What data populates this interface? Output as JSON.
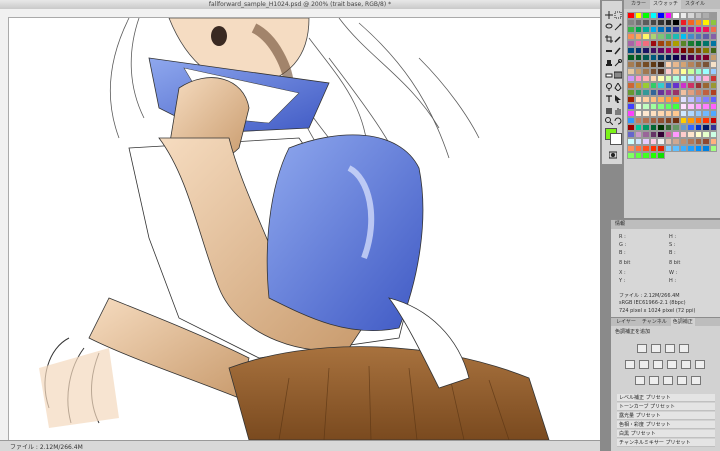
{
  "window": {
    "title": "fallforward_sample_H1024.psd @ 200% (trait base, RGB/8) *"
  },
  "status": {
    "text": "ファイル : 2.12M/266.4M"
  },
  "swatches": {
    "tabs": [
      "カラー",
      "スウォッチ",
      "スタイル"
    ],
    "active_tab": 1,
    "colors": [
      "#ff0000",
      "#ffff00",
      "#00ff00",
      "#00ffff",
      "#0000ff",
      "#ff00ff",
      "#ffffff",
      "#ebebeb",
      "#d6d6d6",
      "#c2c2c2",
      "#adadad",
      "#999999",
      "#858585",
      "#707070",
      "#5c5c5c",
      "#474747",
      "#333333",
      "#1f1f1f",
      "#000000",
      "#ee1d24",
      "#f26522",
      "#f7941d",
      "#fff200",
      "#8dc63f",
      "#39b54a",
      "#00a651",
      "#00a99d",
      "#00aeef",
      "#0072bc",
      "#0054a6",
      "#2e3192",
      "#662d91",
      "#92278f",
      "#ec008c",
      "#ed145b",
      "#f26c4f",
      "#f68e56",
      "#fbaf5d",
      "#fff568",
      "#acd373",
      "#7cc576",
      "#3cb878",
      "#1cbbb4",
      "#00bff3",
      "#448ccb",
      "#5574b9",
      "#605ca8",
      "#8560a8",
      "#a864a8",
      "#f06eaa",
      "#f26d7d",
      "#9e0b0f",
      "#a0410d",
      "#a36209",
      "#aba000",
      "#598527",
      "#197b30",
      "#007236",
      "#00746b",
      "#0076a3",
      "#004a80",
      "#003471",
      "#1b1464",
      "#440e62",
      "#630460",
      "#9e005d",
      "#9e0039",
      "#790000",
      "#7b2e00",
      "#7d4900",
      "#827b00",
      "#406618",
      "#005e20",
      "#005826",
      "#005952",
      "#005b7f",
      "#003663",
      "#002157",
      "#0d004c",
      "#32004b",
      "#4b0049",
      "#7b0046",
      "#7a0026",
      "#c69c6d",
      "#a67c52",
      "#8c6239",
      "#754c24",
      "#603913",
      "#3c2415",
      "#ffd2b0",
      "#e8b88e",
      "#d4a373",
      "#b5835a",
      "#996b46",
      "#7a5336",
      "#f5e1c8",
      "#e6c8a0",
      "#c8a070",
      "#a07850",
      "#785030",
      "#503020",
      "#ffcccc",
      "#ffcc99",
      "#ffff99",
      "#ccff99",
      "#99ffcc",
      "#99ffff",
      "#99ccff",
      "#cc99ff",
      "#ff99cc",
      "#ffb3b3",
      "#ffd9b3",
      "#ffffb3",
      "#d9ffb3",
      "#b3ffd9",
      "#b3ffff",
      "#b3d9ff",
      "#d9b3ff",
      "#ffb3d9",
      "#cc3333",
      "#cc6633",
      "#cc9933",
      "#99cc33",
      "#33cc66",
      "#33cccc",
      "#3366cc",
      "#6633cc",
      "#cc33cc",
      "#cc3366",
      "#993333",
      "#996633",
      "#999933",
      "#669933",
      "#339966",
      "#339999",
      "#336699",
      "#663399",
      "#993399",
      "#993366",
      "#f0c0a0",
      "#e0a080",
      "#d08060",
      "#c06040",
      "#b04020",
      "#a02000",
      "#ffe0c0",
      "#ffd0a0",
      "#ffc080",
      "#ffb060",
      "#ffa040",
      "#ff9020",
      "#e0e0ff",
      "#c0c0ff",
      "#a0a0ff",
      "#8080ff",
      "#6060ff",
      "#4040ff",
      "#e0ffe0",
      "#c0ffc0",
      "#a0ffa0",
      "#80ff80",
      "#60ff60",
      "#40ff40",
      "#ffe0ff",
      "#ffc0ff",
      "#ffa0ff",
      "#ff80ff",
      "#ff60ff",
      "#ff40ff",
      "#fff0e0",
      "#ffe8d0",
      "#ffe0c0",
      "#ffd8b0",
      "#ffd0a0",
      "#ffc890",
      "#d0e8ff",
      "#b0d8ff",
      "#90c8ff",
      "#70b8ff",
      "#50a8ff",
      "#3098ff",
      "#c08060",
      "#b07050",
      "#a06040",
      "#905030",
      "#804020",
      "#703010",
      "#ffcc00",
      "#ff9900",
      "#ff6600",
      "#ff3300",
      "#cc0000",
      "#990000",
      "#00cc99",
      "#009966",
      "#006633",
      "#003300",
      "#336633",
      "#669966",
      "#6699cc",
      "#3366ff",
      "#0033cc",
      "#001a66",
      "#333399",
      "#6666cc",
      "#cc99cc",
      "#996699",
      "#663366",
      "#330033",
      "#cc6699",
      "#ff99ff",
      "#ffcccc",
      "#ffe5cc",
      "#ffffcc",
      "#e5ffcc",
      "#ccffe5",
      "#ccffff",
      "#cce5ff",
      "#e5ccff",
      "#ffcce5",
      "#f2f2f2",
      "#e0c0b0",
      "#d0a890",
      "#c09070",
      "#b07858",
      "#a06040",
      "#904830",
      "#ffb080",
      "#ff9060",
      "#ff7040",
      "#ff5020",
      "#ff3000",
      "#e02000",
      "#80d0ff",
      "#60c0ff",
      "#40b0ff",
      "#20a0ff",
      "#0090ff",
      "#0080e0",
      "#a0ff80",
      "#80ff60",
      "#60ff40",
      "#40ff20",
      "#20ff00",
      "#10e000"
    ]
  },
  "info": {
    "title": "情報",
    "rgb_labels": [
      "R :",
      "G :",
      "B :"
    ],
    "hsb_labels": [
      "H :",
      "S :",
      "B :"
    ],
    "bits_left": "8 bit",
    "bits_right": "8 bit",
    "xy": [
      "X :",
      "Y :"
    ],
    "wh": [
      "W :",
      "H :"
    ],
    "file": "ファイル : 2.12M/266.4M",
    "profile": "sRGB IEC61966-2.1 (8bpc)",
    "dims": "724 pixel x 1024 pixel (72 ppi)"
  },
  "adjust": {
    "tabs": [
      "レイヤー",
      "チャンネル",
      "色調補正"
    ],
    "active_tab": 2,
    "title": "色調補正を追加",
    "presets": [
      "レベル補正 プリセット",
      "トーンカーブ プリセット",
      "露光量 プリセット",
      "色相・彩度 プリセット",
      "白黒 プリセット",
      "チャンネルミキサー プリセット"
    ]
  }
}
